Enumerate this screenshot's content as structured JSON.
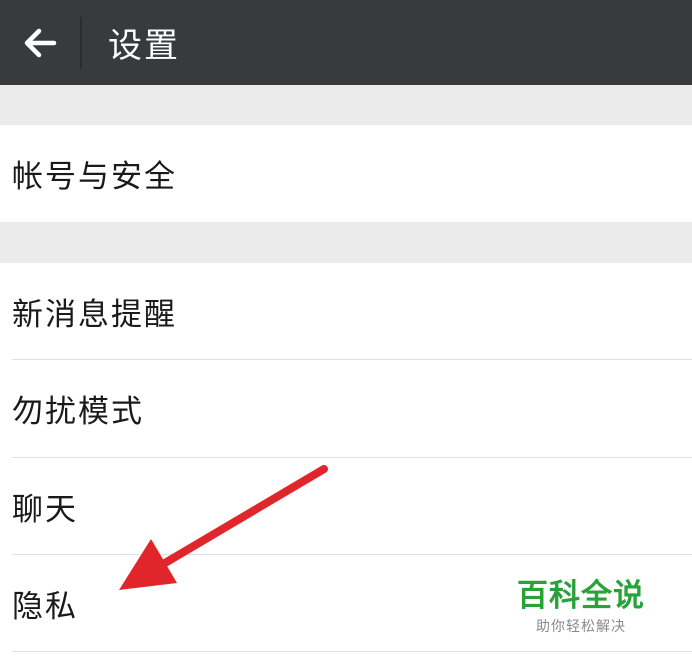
{
  "header": {
    "title": "设置",
    "back_icon": "back-arrow-icon"
  },
  "settings": {
    "account_security": "帐号与安全",
    "new_message_alert": "新消息提醒",
    "do_not_disturb": "勿扰模式",
    "chat": "聊天",
    "privacy": "隐私"
  },
  "annotation": {
    "arrow_color": "#e0262b",
    "points_to": "privacy"
  },
  "watermark": {
    "title": "百科全说",
    "subtitle": "助你轻松解决",
    "color": "#2aa23a"
  },
  "colors": {
    "titlebar": "#393a3e",
    "section_gap": "#ebebeb"
  }
}
